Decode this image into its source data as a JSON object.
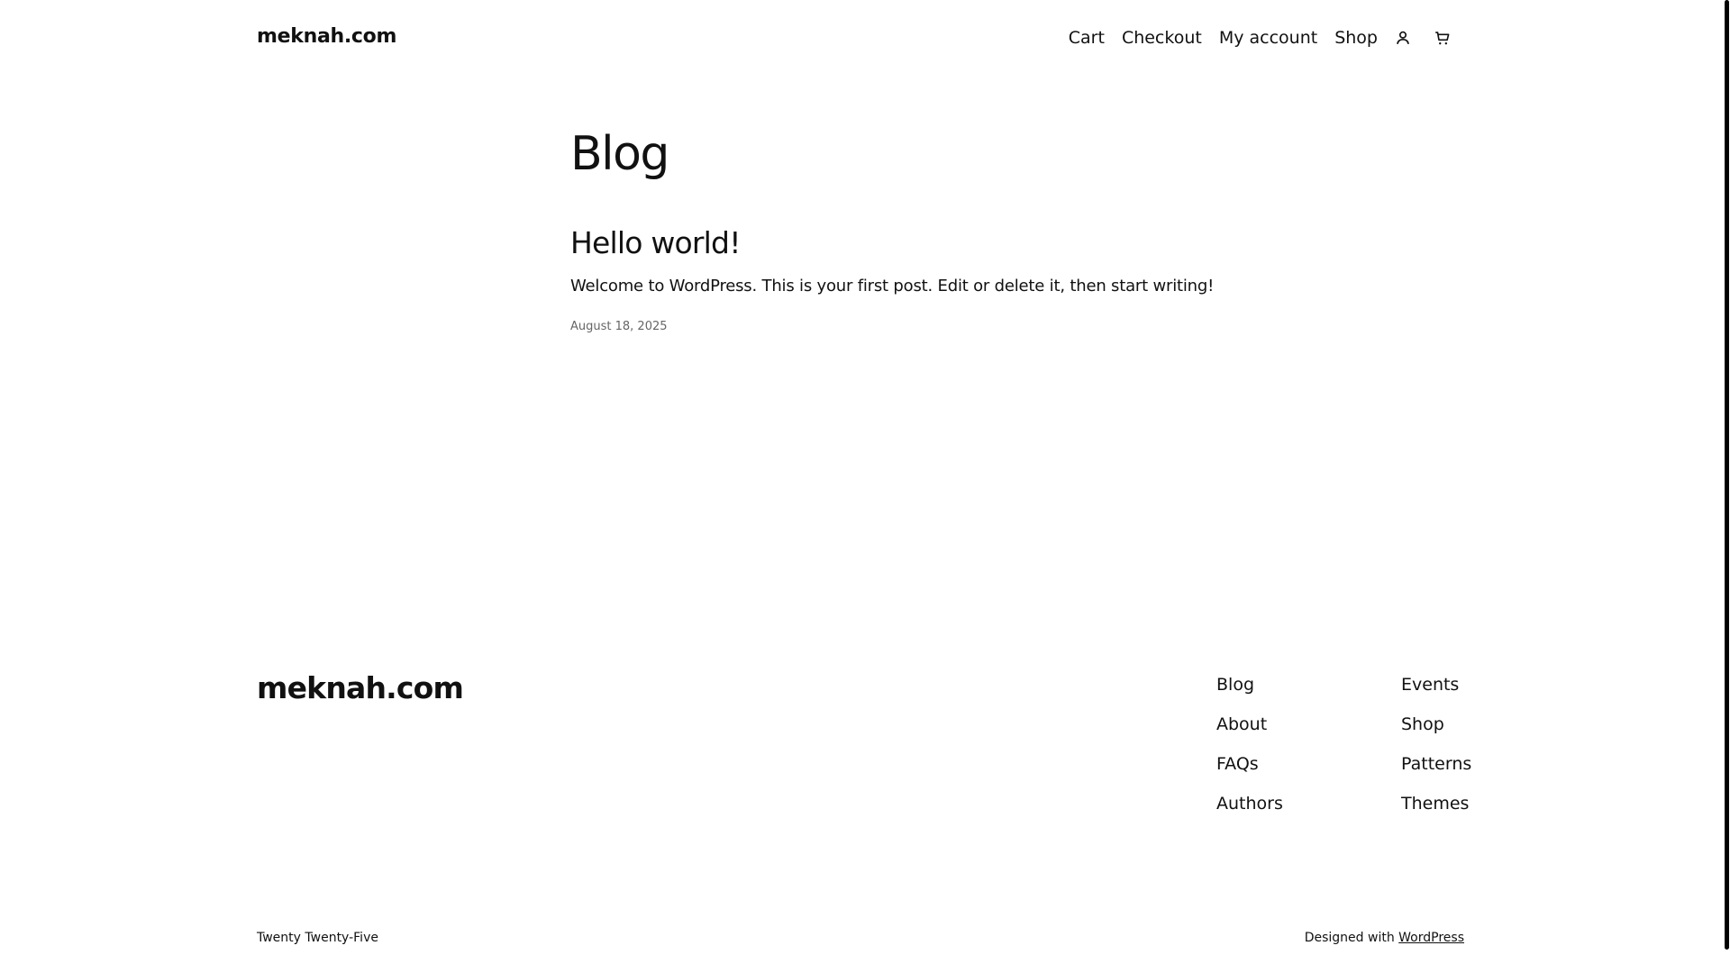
{
  "header": {
    "site_title": "meknah.com",
    "nav": [
      {
        "label": "Cart"
      },
      {
        "label": "Checkout"
      },
      {
        "label": "My account"
      },
      {
        "label": "Shop"
      }
    ],
    "icons": [
      "account-icon",
      "cart-icon"
    ]
  },
  "main": {
    "page_title": "Blog",
    "posts": [
      {
        "title": "Hello world!",
        "excerpt": "Welcome to WordPress. This is your first post. Edit or delete it, then start writing!",
        "date": "August 18, 2025"
      }
    ]
  },
  "footer": {
    "site_title": "meknah.com",
    "col1": [
      {
        "label": "Blog"
      },
      {
        "label": "About"
      },
      {
        "label": "FAQs"
      },
      {
        "label": "Authors"
      }
    ],
    "col2": [
      {
        "label": "Events"
      },
      {
        "label": "Shop"
      },
      {
        "label": "Patterns"
      },
      {
        "label": "Themes"
      }
    ],
    "theme_credit": "Twenty Twenty-Five",
    "designed_with": "Designed with",
    "designed_with_link": "WordPress"
  }
}
